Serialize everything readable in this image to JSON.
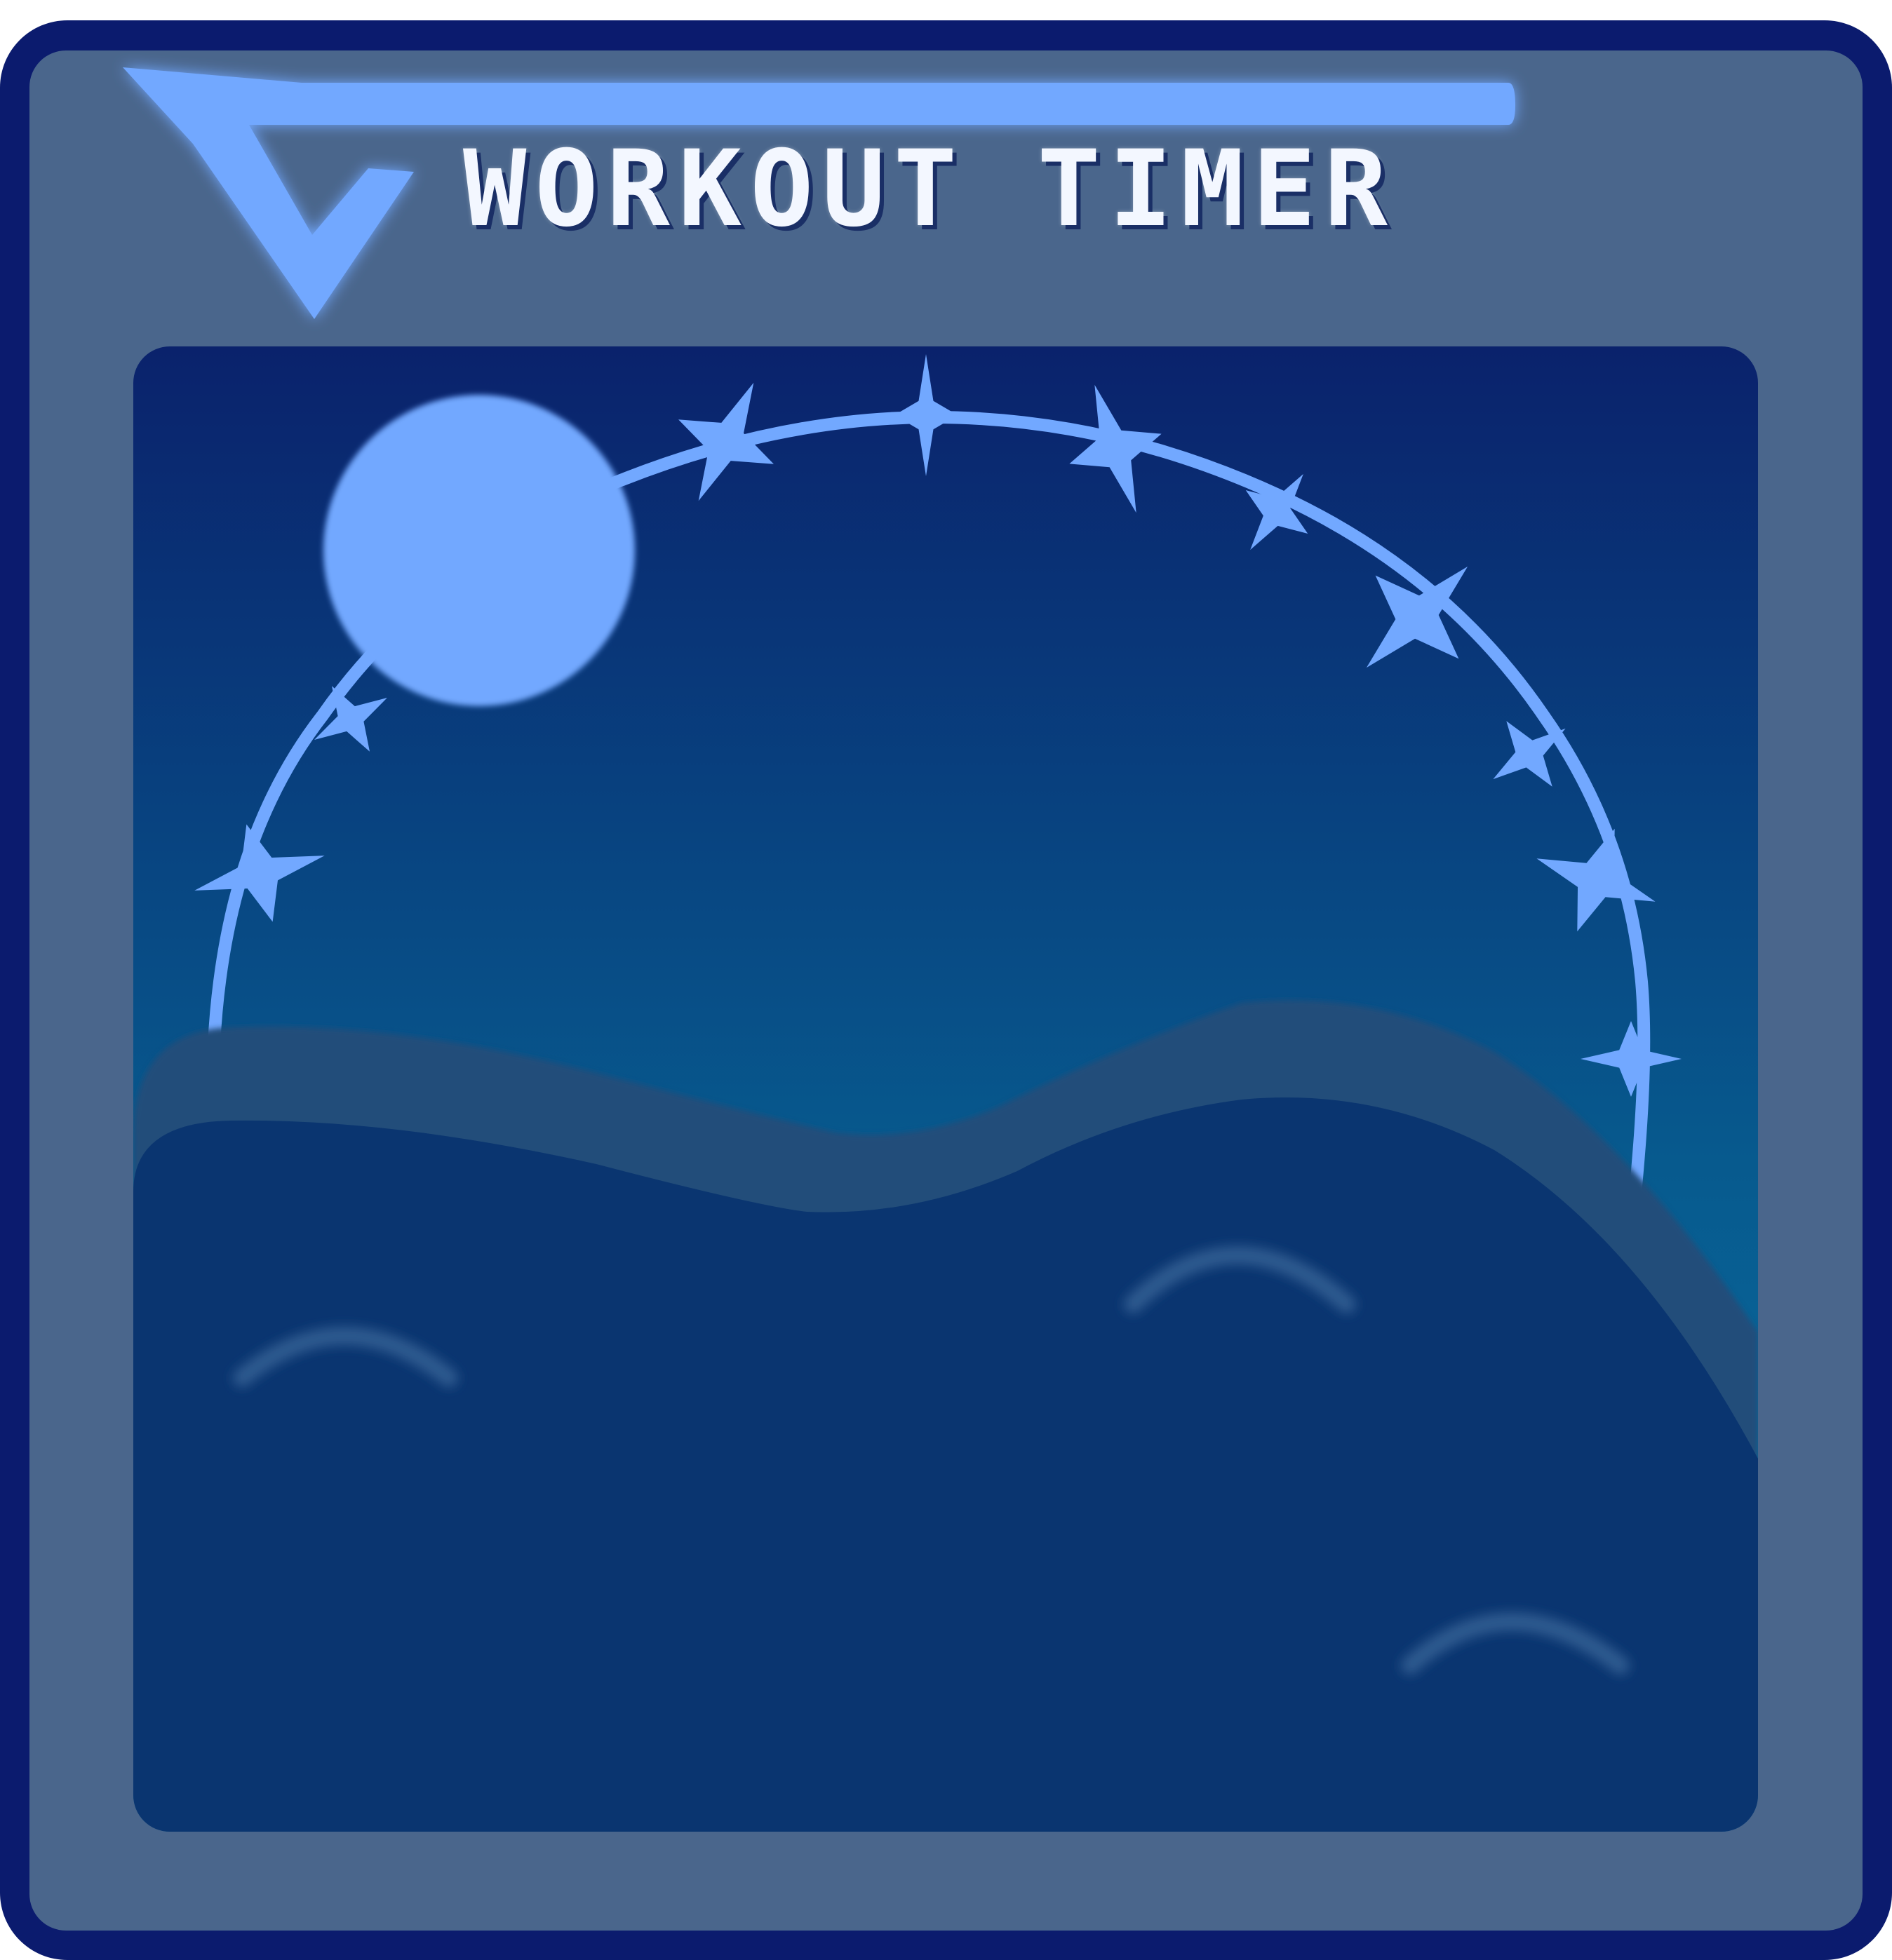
{
  "app": {
    "title": "WORKOUT TIMER"
  },
  "icons": {
    "back": "back-chevron-icon",
    "sun": "sun-icon",
    "stars": "star-icon"
  },
  "colors": {
    "outer_border": "#0b1b6e",
    "frame_fill": "#4a668c",
    "accent": "#72a8ff",
    "scene_top": "#0a2670",
    "scene_bottom": "#0a6e9e",
    "hill_back": "#234d7a",
    "hill_front": "#0a3570",
    "title_text": "#f3f7ff"
  }
}
